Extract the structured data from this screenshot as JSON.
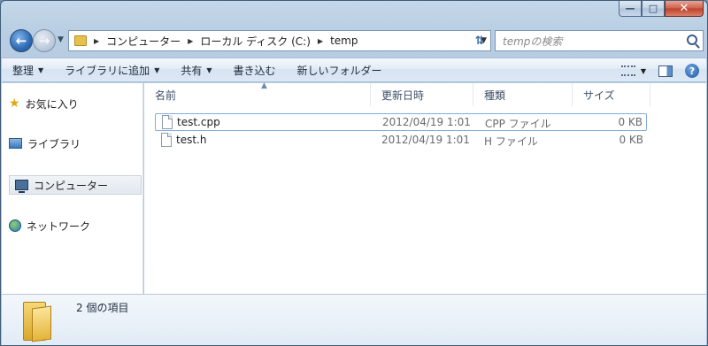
{
  "window": {
    "caption_buttons": [
      "minimize",
      "maximize",
      "close"
    ]
  },
  "nav": {
    "breadcrumb": [
      "コンピューター",
      "ローカル ディスク (C:)",
      "temp"
    ]
  },
  "search": {
    "placeholder": "tempの検索"
  },
  "toolbar": {
    "organize": "整理",
    "add_to_library": "ライブラリに追加",
    "share": "共有",
    "burn": "書き込む",
    "new_folder": "新しいフォルダー"
  },
  "sidebar": {
    "items": [
      {
        "label": "お気に入り",
        "icon": "star-icon"
      },
      {
        "label": "ライブラリ",
        "icon": "library-icon"
      },
      {
        "label": "コンピューター",
        "icon": "computer-icon",
        "selected": true
      },
      {
        "label": "ネットワーク",
        "icon": "network-icon"
      }
    ]
  },
  "files": {
    "columns": [
      "名前",
      "更新日時",
      "種類",
      "サイズ"
    ],
    "rows": [
      {
        "name": "test.cpp",
        "modified": "2012/04/19 1:01",
        "type": "CPP ファイル",
        "size": "0 KB",
        "selected": true
      },
      {
        "name": "test.h",
        "modified": "2012/04/19 1:01",
        "type": "H ファイル",
        "size": "0 KB",
        "selected": false
      }
    ]
  },
  "status": {
    "text": "2 個の項目"
  },
  "colors": {
    "accent": "#3f6fb0",
    "selection_border": "#84acdd"
  }
}
